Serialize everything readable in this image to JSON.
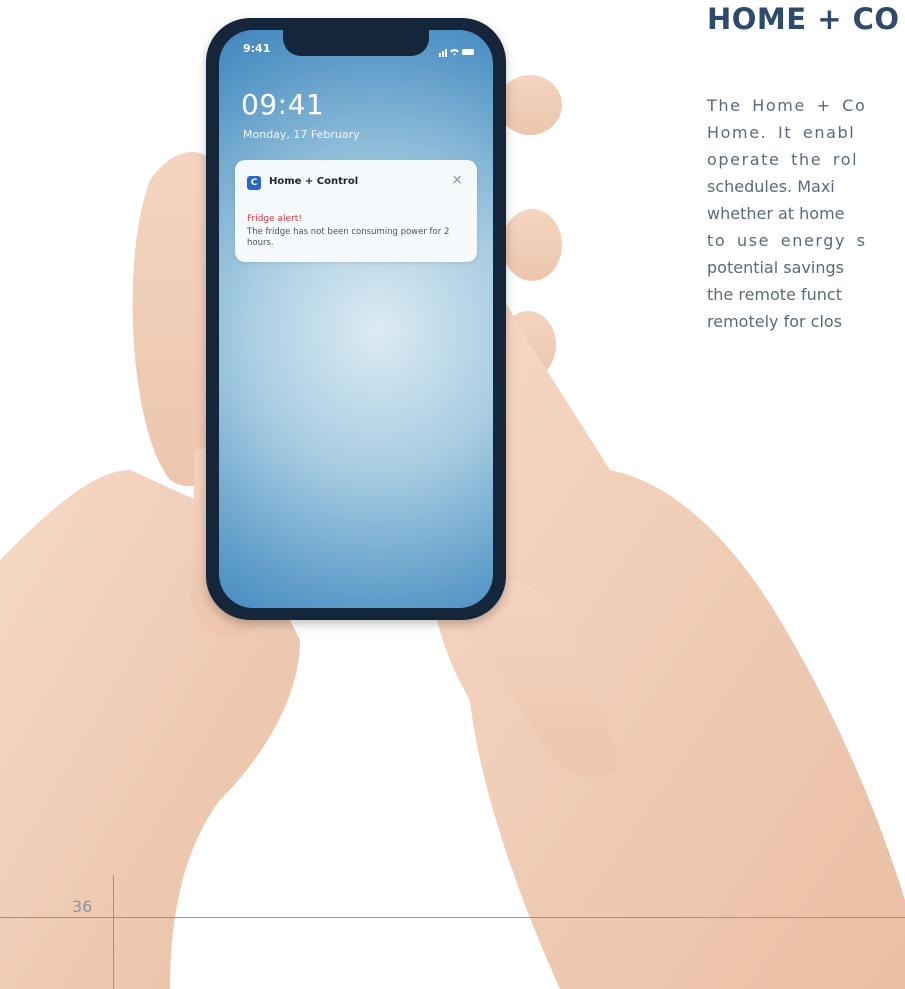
{
  "article": {
    "heading": "HOME + CO",
    "lines": [
      "The Home + Co",
      "Home. It enabl",
      "operate the rol",
      "schedules. Maxi",
      "whether at home",
      "to use energy s",
      "potential savings",
      "the remote funct",
      "remotely for clos"
    ]
  },
  "phone": {
    "status_time": "9:41",
    "lock_time": "09:41",
    "lock_date": "Monday, 17 February",
    "notification": {
      "app_icon_glyph": "C",
      "app_name": "Home + Control",
      "close_glyph": "×",
      "title": "Fridge alert!",
      "body": "The fridge has not been consuming power for 2 hours."
    }
  },
  "page_number": "36",
  "colors": {
    "heading": "#2f4b6c",
    "body_text": "#5a6a7c",
    "phone_frame": "#16263a",
    "notification_alert": "#d9363e",
    "app_icon": "#2b66c2",
    "rule": "#8a97a6"
  },
  "icons": [
    "signal-icon",
    "wifi-icon",
    "battery-icon",
    "app-icon",
    "close-icon"
  ]
}
